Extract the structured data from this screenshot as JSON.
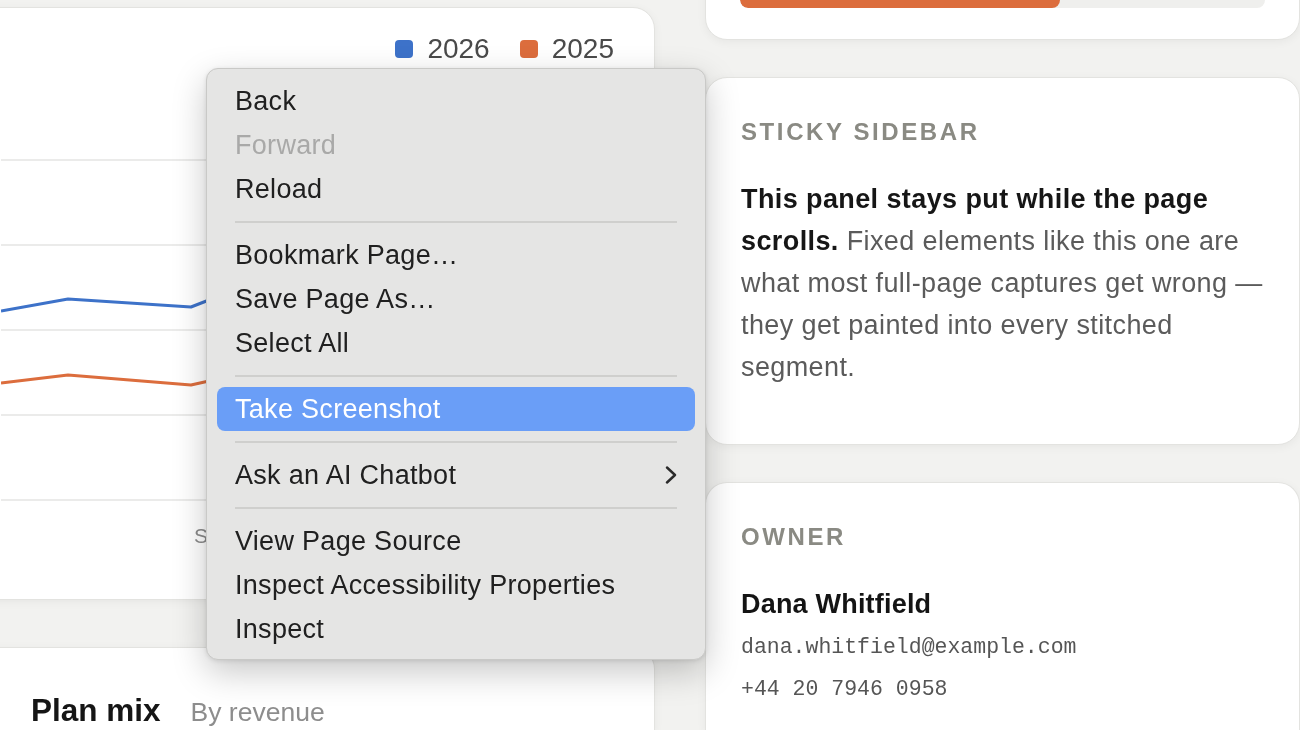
{
  "chart_card": {
    "legend": [
      {
        "label": "2026",
        "color": "#3d72c9"
      },
      {
        "label": "2025",
        "color": "#dc6d3d"
      }
    ],
    "x_axis_labels": [
      "S"
    ]
  },
  "plan_mix_card": {
    "title": "Plan mix",
    "subtitle": "By revenue"
  },
  "progress_card": {
    "progress": {
      "level": 0.61
    }
  },
  "sticky_sidebar": {
    "heading": "STICKY SIDEBAR",
    "text": "**This panel stays put while the page scrolls.** Fixed elements like this one are what most full-page captures get wrong — they get painted into every stitched segment."
  },
  "owner": {
    "heading": "OWNER",
    "name": "Dana Whitfield",
    "email": "dana.whitfield@example.com",
    "phone": "+44 20 7946 0958"
  },
  "context_menu": {
    "items": [
      {
        "kind": "item",
        "label": "Back",
        "disabled": false,
        "selected": false,
        "submenu": false
      },
      {
        "kind": "item",
        "label": "Forward",
        "disabled": true,
        "selected": false,
        "submenu": false
      },
      {
        "kind": "item",
        "label": "Reload",
        "disabled": false,
        "selected": false,
        "submenu": false
      },
      {
        "kind": "separator"
      },
      {
        "kind": "item",
        "label": "Bookmark Page…",
        "disabled": false,
        "selected": false,
        "submenu": false
      },
      {
        "kind": "item",
        "label": "Save Page As…",
        "disabled": false,
        "selected": false,
        "submenu": false
      },
      {
        "kind": "item",
        "label": "Select All",
        "disabled": false,
        "selected": false,
        "submenu": false
      },
      {
        "kind": "separator"
      },
      {
        "kind": "item",
        "label": "Take Screenshot",
        "disabled": false,
        "selected": true,
        "submenu": false
      },
      {
        "kind": "separator"
      },
      {
        "kind": "item",
        "label": "Ask an AI Chatbot",
        "disabled": false,
        "selected": false,
        "submenu": true
      },
      {
        "kind": "separator"
      },
      {
        "kind": "item",
        "label": "View Page Source",
        "disabled": false,
        "selected": false,
        "submenu": false
      },
      {
        "kind": "item",
        "label": "Inspect Accessibility Properties",
        "disabled": false,
        "selected": false,
        "submenu": false
      },
      {
        "kind": "item",
        "label": "Inspect",
        "disabled": false,
        "selected": false,
        "submenu": false
      }
    ]
  }
}
